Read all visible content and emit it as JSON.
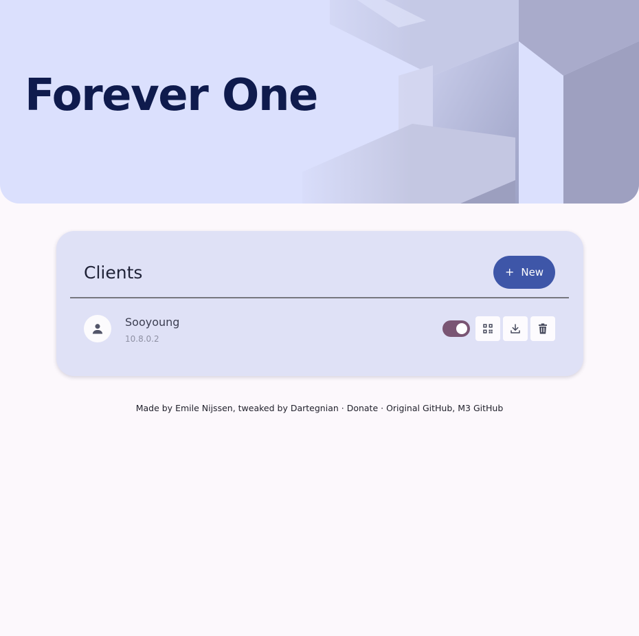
{
  "header": {
    "title": "Forever One"
  },
  "clients_card": {
    "title": "Clients",
    "new_button_label": "New",
    "new_button_icon": "plus-icon",
    "clients": [
      {
        "name": "Sooyoung",
        "ip": "10.8.0.2",
        "enabled": true,
        "avatar_icon": "person-icon",
        "actions": [
          "qr-code-icon",
          "download-icon",
          "trash-icon"
        ]
      }
    ]
  },
  "footer": {
    "made_by": "Made by",
    "author": "Emile Nijssen",
    "tweaked_by": ", tweaked by",
    "tweaker": "Dartegnian",
    "sep1": " · ",
    "donate": "Donate",
    "sep2": " · ",
    "original_github": "Original GitHub",
    "comma": ", ",
    "m3_github": "M3 GitHub"
  },
  "colors": {
    "hero_bg": "#dbe0fd",
    "title": "#0f1b4d",
    "card_bg": "#dfe1f6",
    "primary_button": "#3e56a8",
    "toggle_on": "#7a5573",
    "page_bg": "#fcf8fc"
  }
}
